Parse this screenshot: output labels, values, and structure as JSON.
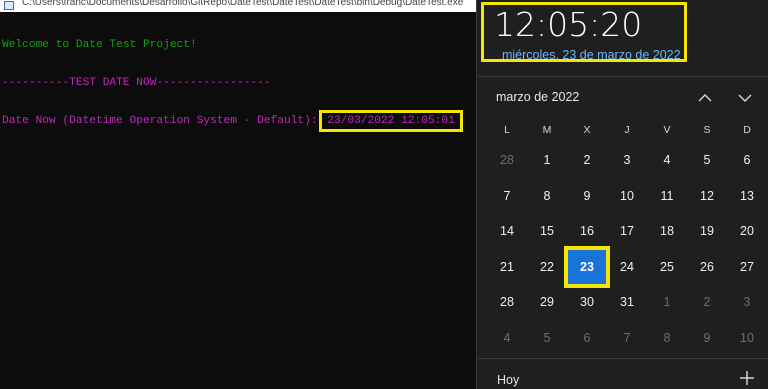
{
  "console": {
    "title": "C:\\Users\\franc\\Documents\\Desarrollo\\GitRepo\\DateTest\\DateTest\\DateTest\\bin\\Debug\\DateTest.exe",
    "lines": {
      "welcome": "Welcome to Date Test Project!",
      "separator": "----------TEST DATE NOW-----------------",
      "date_label": "Date Now (Datetime Operation System - Default):",
      "date_value": "23/03/2022 12:05:01"
    },
    "colors": {
      "green": "#13a10e",
      "magenta": "#c026c0",
      "highlight": "#f5e600"
    }
  },
  "flyout": {
    "time": "12:05:20",
    "date_long": "miércoles, 23 de marzo de 2022",
    "month_label": "marzo de 2022",
    "weekdays": [
      "L",
      "M",
      "X",
      "J",
      "V",
      "S",
      "D"
    ],
    "weeks": [
      [
        {
          "d": "28",
          "m": true
        },
        {
          "d": "1"
        },
        {
          "d": "2"
        },
        {
          "d": "3"
        },
        {
          "d": "4"
        },
        {
          "d": "5"
        },
        {
          "d": "6"
        }
      ],
      [
        {
          "d": "7"
        },
        {
          "d": "8"
        },
        {
          "d": "9"
        },
        {
          "d": "10"
        },
        {
          "d": "11"
        },
        {
          "d": "12"
        },
        {
          "d": "13"
        }
      ],
      [
        {
          "d": "14"
        },
        {
          "d": "15"
        },
        {
          "d": "16"
        },
        {
          "d": "17"
        },
        {
          "d": "18"
        },
        {
          "d": "19"
        },
        {
          "d": "20"
        }
      ],
      [
        {
          "d": "21"
        },
        {
          "d": "22"
        },
        {
          "d": "23",
          "today": true
        },
        {
          "d": "24"
        },
        {
          "d": "25"
        },
        {
          "d": "26"
        },
        {
          "d": "27"
        }
      ],
      [
        {
          "d": "28"
        },
        {
          "d": "29"
        },
        {
          "d": "30"
        },
        {
          "d": "31"
        },
        {
          "d": "1",
          "m": true
        },
        {
          "d": "2",
          "m": true
        },
        {
          "d": "3",
          "m": true
        }
      ],
      [
        {
          "d": "4",
          "m": true
        },
        {
          "d": "5",
          "m": true
        },
        {
          "d": "6",
          "m": true
        },
        {
          "d": "7",
          "m": true
        },
        {
          "d": "8",
          "m": true
        },
        {
          "d": "9",
          "m": true
        },
        {
          "d": "10",
          "m": true
        }
      ]
    ],
    "today_label": "Hoy",
    "accent": "#1a73d9",
    "date_color": "#6cb8f6"
  }
}
